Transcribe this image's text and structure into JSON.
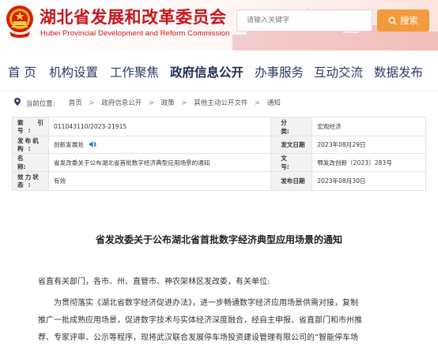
{
  "header": {
    "title": "湖北省发展和改革委员会",
    "subtitle": "Hubei Provincial Development and Reform Commission",
    "search_placeholder": "请输入关键字",
    "search_label": "搜索"
  },
  "nav": {
    "items": [
      "首 页",
      "机构设置",
      "工作聚焦",
      "政府信息公开",
      "办事服务",
      "互动交流",
      "数据发布"
    ],
    "active": "政府信息公开"
  },
  "breadcrumb": {
    "prefix": "当前位置:",
    "items": [
      "首页",
      "政府信息公开",
      "政策",
      "其他主动公开文件",
      "通知"
    ]
  },
  "info": {
    "index_label": [
      "索",
      "引",
      "号:"
    ],
    "index_value": "011043110/2023-21915",
    "category_label": "分　　类:",
    "category_value": "宏观经济",
    "publisher_label": [
      "发布机",
      "构:"
    ],
    "publisher_value": "创新发展处",
    "issue_date_label": "发文日期",
    "issue_date_value": "2023年08月29日",
    "name_label": "名　　称:",
    "name_value": "省发改委关于公布湖北省首批数字经济典型应用场景的通知",
    "doc_no_label": "文　　号:",
    "doc_no_value": "鄂发改创新〔2023〕283号",
    "status_label": [
      "效力状",
      "态:"
    ],
    "status_value": "有效",
    "publish_date_label": "发布日期",
    "publish_date_value": "2023年08月30日"
  },
  "article": {
    "title": "省发改委关于公布湖北省首批数字经济典型应用场景的通知",
    "greeting": "省直有关部门，各市、州、直管市、神农架林区发改委，有关单位:",
    "line1": "为贯彻落实《湖北省数字经济促进办法》，进一步畅通数字经济应用场景供需对接，复制",
    "line2": "推广一批成熟应用场景，促进数字技术与实体经济深度融合，经自主申报、省直部门和市州推",
    "line3": "荐、专家评审、公示等程序，现将武汉联合发展停车场投资建设管理有限公司的“智能停车场"
  },
  "colors": {
    "brand_red": "#c8161d",
    "search_orange": "#f39a3c",
    "nav_text": "#2e3a64"
  }
}
